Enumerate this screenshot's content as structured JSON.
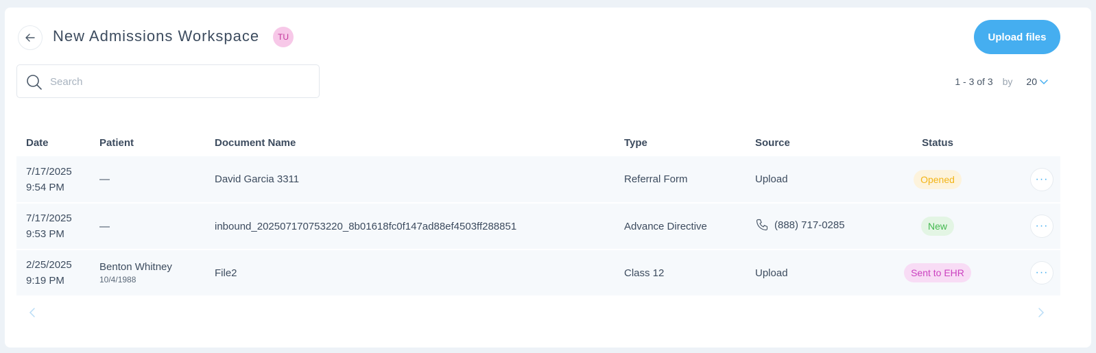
{
  "header": {
    "title": "New Admissions Workspace",
    "avatar_initials": "TU",
    "upload_label": "Upload files"
  },
  "search": {
    "placeholder": "Search",
    "value": ""
  },
  "pagination": {
    "range": "1 - 3 of 3",
    "by_label": "by",
    "page_size": "20"
  },
  "table": {
    "columns": [
      "Date",
      "Patient",
      "Document Name",
      "Type",
      "Source",
      "Status"
    ],
    "rows": [
      {
        "date": "7/17/2025",
        "time": "9:54 PM",
        "patient": "—",
        "patient_dob": "",
        "document": "David Garcia 3311",
        "type": "Referral Form",
        "source": "Upload",
        "status": "Opened"
      },
      {
        "date": "7/17/2025",
        "time": "9:53 PM",
        "patient": "—",
        "patient_dob": "",
        "document": "inbound_202507170753220_8b01618fc0f147ad88ef4503ff288851",
        "type": "Advance Directive",
        "source": "(888) 717-0285",
        "status": "New"
      },
      {
        "date": "2/25/2025",
        "time": "9:19 PM",
        "patient": "Benton Whitney",
        "patient_dob": "10/4/1988",
        "document": "File2",
        "type": "Class 12",
        "source": "Upload",
        "status": "Sent to EHR"
      }
    ],
    "more_label": "···"
  },
  "colors": {
    "accent": "#45aef0",
    "status_opened": "#f2b417",
    "status_new": "#43b84f",
    "status_ehr": "#cb42c0"
  },
  "icons": [
    "arrow-left-icon",
    "search-icon",
    "chevron-down-icon",
    "phone-icon",
    "chevron-left-icon",
    "chevron-right-icon"
  ]
}
